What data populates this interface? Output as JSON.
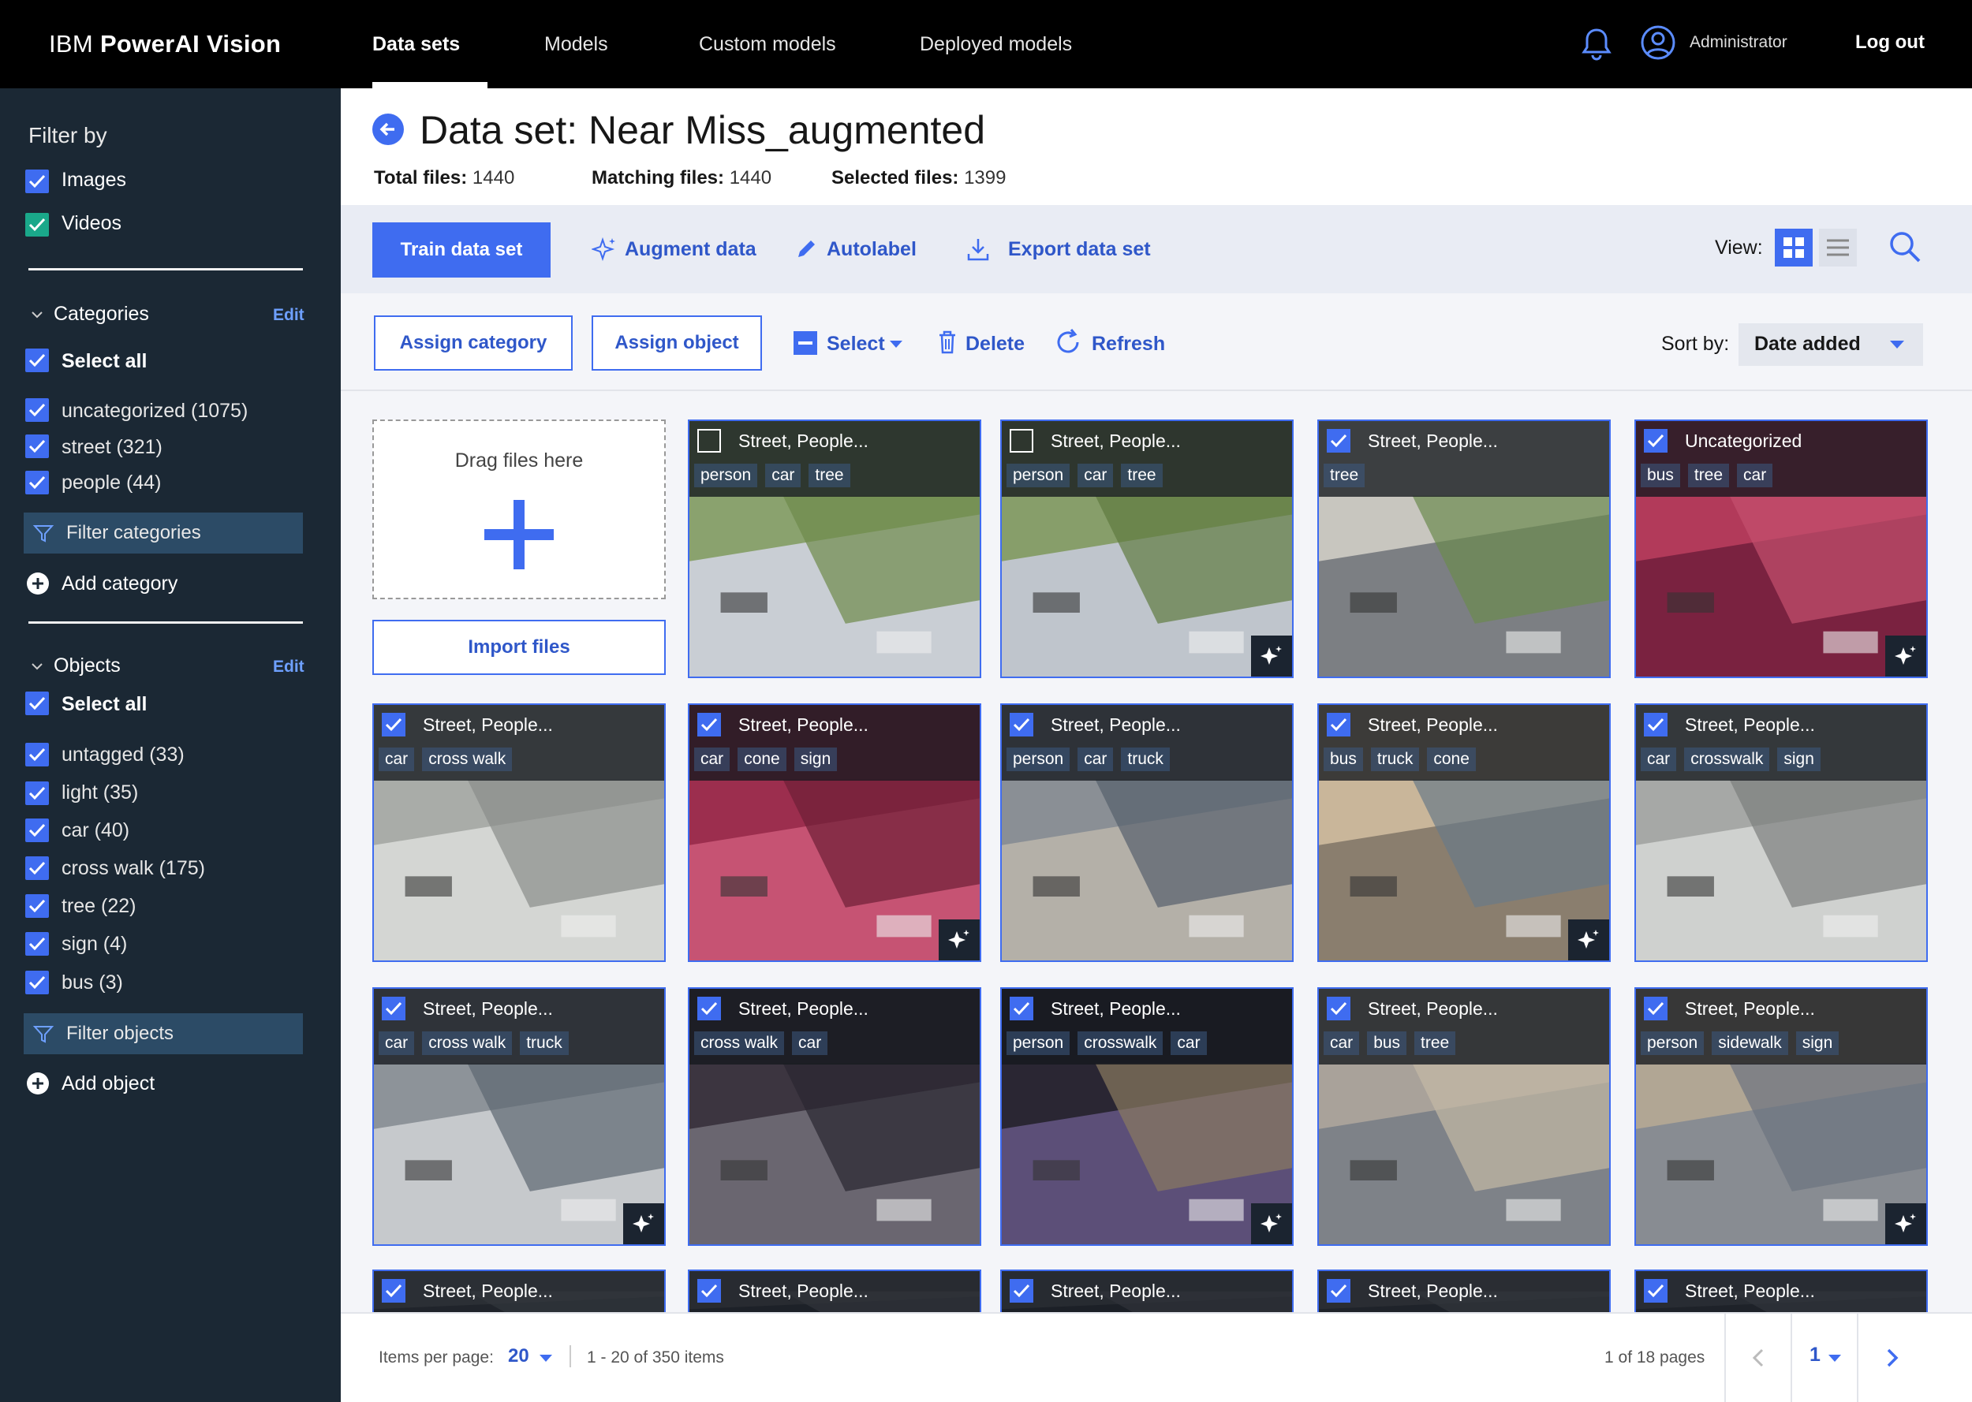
{
  "brand": {
    "prefix": "IBM",
    "name": "PowerAI Vision"
  },
  "nav": [
    "Data sets",
    "Models",
    "Custom models",
    "Deployed models"
  ],
  "user": {
    "name": "Administrator",
    "logout": "Log out"
  },
  "sidebar": {
    "filter_title": "Filter by",
    "media": [
      "Images",
      "Videos"
    ],
    "categories": {
      "title": "Categories",
      "edit": "Edit",
      "select_all": "Select all",
      "items": [
        "uncategorized (1075)",
        "street (321)",
        "people (44)"
      ],
      "filter_btn": "Filter categories",
      "add": "Add category"
    },
    "objects": {
      "title": "Objects",
      "edit": "Edit",
      "select_all": "Select all",
      "items": [
        "untagged (33)",
        "light (35)",
        "car (40)",
        "cross walk (175)",
        "tree (22)",
        "sign (4)",
        "bus (3)"
      ],
      "filter_btn": "Filter objects",
      "add": "Add object"
    }
  },
  "header": {
    "title": "Data set: Near Miss_augmented",
    "stats": [
      {
        "label": "Total files:",
        "value": "1440"
      },
      {
        "label": "Matching files:",
        "value": "1440"
      },
      {
        "label": "Selected files:",
        "value": "1399"
      }
    ]
  },
  "toolbar": {
    "train": "Train data set",
    "augment": "Augment data",
    "autolabel": "Autolabel",
    "export": "Export data set",
    "view_label": "View:",
    "assign_category": "Assign category",
    "assign_object": "Assign object",
    "select": "Select",
    "delete": "Delete",
    "refresh": "Refresh",
    "sort_label": "Sort by:",
    "sort_value": "Date added"
  },
  "upload": {
    "drag_text": "Drag files here",
    "import": "Import files"
  },
  "cards": [
    {
      "title": "Street, People...",
      "tags": [
        "person",
        "car",
        "tree"
      ],
      "checked": false,
      "aug": false
    },
    {
      "title": "Street, People...",
      "tags": [
        "person",
        "car",
        "tree"
      ],
      "checked": false,
      "aug": true
    },
    {
      "title": "Street, People...",
      "tags": [
        "tree"
      ],
      "checked": true,
      "aug": false
    },
    {
      "title": "Uncategorized",
      "tags": [
        "bus",
        "tree",
        "car"
      ],
      "checked": true,
      "aug": true
    },
    {
      "title": "Street, People...",
      "tags": [
        "car",
        "cross walk"
      ],
      "checked": true,
      "aug": false
    },
    {
      "title": "Street, People...",
      "tags": [
        "car",
        "cone",
        "sign"
      ],
      "checked": true,
      "aug": true
    },
    {
      "title": "Street, People...",
      "tags": [
        "person",
        "car",
        "truck"
      ],
      "checked": true,
      "aug": false
    },
    {
      "title": "Street, People...",
      "tags": [
        "bus",
        "truck",
        "cone"
      ],
      "checked": true,
      "aug": true
    },
    {
      "title": "Street, People...",
      "tags": [
        "car",
        "crosswalk",
        "sign"
      ],
      "checked": true,
      "aug": false
    },
    {
      "title": "Street, People...",
      "tags": [
        "car",
        "cross walk",
        "truck"
      ],
      "checked": true,
      "aug": true
    },
    {
      "title": "Street, People...",
      "tags": [
        "cross walk",
        "car"
      ],
      "checked": true,
      "aug": false
    },
    {
      "title": "Street, People...",
      "tags": [
        "person",
        "crosswalk",
        "car"
      ],
      "checked": true,
      "aug": true
    },
    {
      "title": "Street, People...",
      "tags": [
        "car",
        "bus",
        "tree"
      ],
      "checked": true,
      "aug": false
    },
    {
      "title": "Street, People...",
      "tags": [
        "person",
        "sidewalk",
        "sign"
      ],
      "checked": true,
      "aug": true
    },
    {
      "title": "Street, People...",
      "tags": [],
      "checked": true,
      "aug": false
    },
    {
      "title": "Street, People...",
      "tags": [],
      "checked": true,
      "aug": false
    },
    {
      "title": "Street, People...",
      "tags": [],
      "checked": true,
      "aug": false
    },
    {
      "title": "Street, People...",
      "tags": [],
      "checked": true,
      "aug": false
    },
    {
      "title": "Street, People...",
      "tags": [],
      "checked": true,
      "aug": false
    }
  ],
  "footer": {
    "items_per_page_label": "Items per page:",
    "items_per_page": "20",
    "range": "1 - 20 of 350 items",
    "pages": "1 of 18 pages",
    "page": "1"
  },
  "colors": {
    "accent": "#3f6cf0",
    "sidebar": "#1b2834",
    "topbar": "#000000",
    "teal": "#1aa88a"
  }
}
